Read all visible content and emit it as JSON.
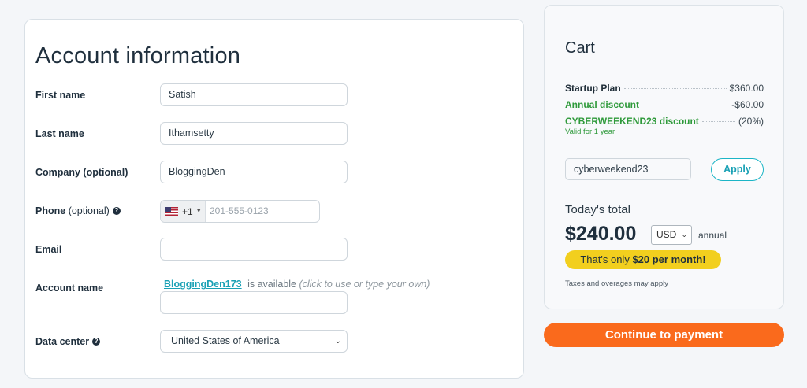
{
  "form": {
    "title": "Account information",
    "first_name": {
      "label": "First name",
      "value": "Satish"
    },
    "last_name": {
      "label": "Last name",
      "value": "Ithamsetty"
    },
    "company": {
      "label": "Company (optional)",
      "value": "BloggingDen"
    },
    "phone": {
      "label": "Phone",
      "optional": "(optional)",
      "country_code": "+1",
      "placeholder": "201-555-0123"
    },
    "email": {
      "label": "Email",
      "value": ""
    },
    "account_name": {
      "label": "Account name",
      "suggestion": "BloggingDen173",
      "available_text": "is available",
      "hint": "(click to use or type your own)",
      "value": ""
    },
    "data_center": {
      "label": "Data center",
      "value": "United States of America"
    }
  },
  "cart": {
    "title": "Cart",
    "items": [
      {
        "name": "Startup Plan",
        "amount": "$360.00",
        "kind": "plan"
      },
      {
        "name": "Annual discount",
        "amount": "-$60.00",
        "kind": "discount"
      },
      {
        "name": "CYBERWEEKEND23 discount",
        "amount": "(20%)",
        "kind": "discount"
      }
    ],
    "coupon_note": "Valid for 1 year",
    "coupon_value": "cyberweekend23",
    "apply_label": "Apply",
    "today_label": "Today's total",
    "total": "$240.00",
    "currency": "USD",
    "period": "annual",
    "monthly_prefix": "That's only ",
    "monthly_value": "$20 per month!",
    "tax_note": "Taxes and overages may apply"
  },
  "continue_label": "Continue to payment",
  "colors": {
    "accent": "#1aa1b5",
    "cta": "#fa6a1c",
    "discount": "#2f9a3b",
    "highlight": "#f2cf1e"
  }
}
